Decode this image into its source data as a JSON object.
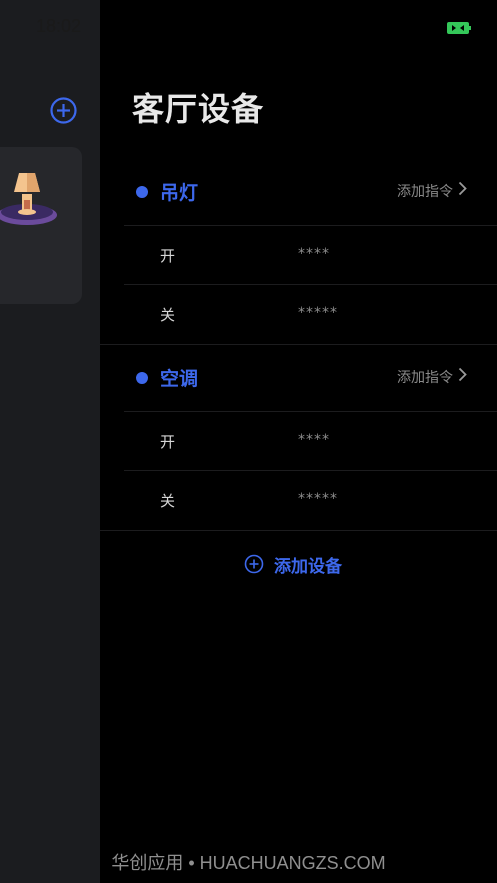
{
  "status_bar": {
    "time": "18:02"
  },
  "drawer": {
    "title": "客厅设备",
    "groups": [
      {
        "name": "吊灯",
        "add_command_label": "添加指令",
        "commands": [
          {
            "name": "开",
            "code": "****"
          },
          {
            "name": "关",
            "code": "*****"
          }
        ]
      },
      {
        "name": "空调",
        "add_command_label": "添加指令",
        "commands": [
          {
            "name": "开",
            "code": "****"
          },
          {
            "name": "关",
            "code": "*****"
          }
        ]
      }
    ],
    "add_device_label": "添加设备"
  },
  "watermark": "华创应用 • HUACHUANGZS.COM",
  "colors": {
    "accent": "#3d68ec",
    "battery": "#34c759"
  },
  "icons": [
    "plus-circle-icon",
    "lamp-icon",
    "battery-icon",
    "chevron-right-icon"
  ]
}
